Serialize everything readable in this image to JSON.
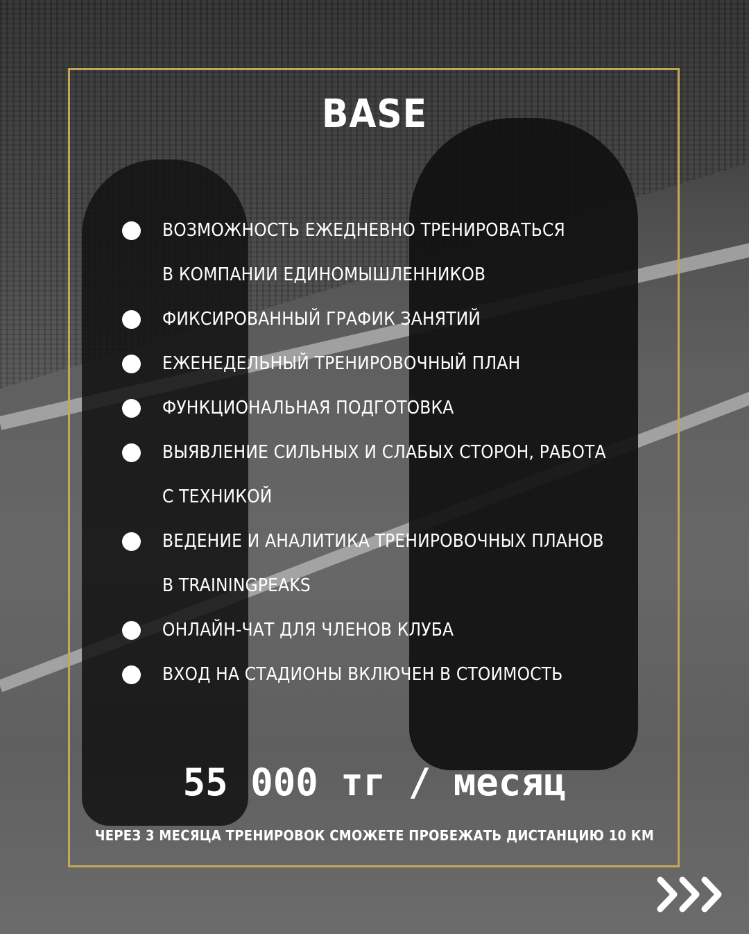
{
  "card": {
    "title": "BASE",
    "features": [
      "ВОЗМОЖНОСТЬ ЕЖЕДНЕВНО ТРЕНИРОВАТЬСЯ",
      "В КОМПАНИИ ЕДИНОМЫШЛЕННИКОВ",
      "ФИКСИРОВАННЫЙ ГРАФИК ЗАНЯТИЙ",
      "ЕЖЕНЕДЕЛЬНЫЙ ТРЕНИРОВОЧНЫЙ ПЛАН",
      "ФУНКЦИОНАЛЬНАЯ ПОДГОТОВКА",
      "ВЫЯВЛЕНИЕ СИЛЬНЫХ И СЛАБЫХ СТОРОН, РАБОТА",
      "С ТЕХНИКОЙ",
      "ВЕДЕНИЕ И АНАЛИТИКА ТРЕНИРОВОЧНЫХ ПЛАНОВ",
      "В TRAININGPEAKS",
      "ОНЛАЙН-ЧАТ ДЛЯ ЧЛЕНОВ КЛУБА",
      "ВХОД НА СТАДИОНЫ ВКЛЮЧЕН В СТОИМОСТЬ"
    ],
    "bulleted": [
      true,
      false,
      true,
      true,
      true,
      true,
      false,
      true,
      false,
      true,
      true
    ],
    "price": "55 000 тг / месяц",
    "note": "ЧЕРЕЗ 3 МЕСЯЦА ТРЕНИРОВОК СМОЖЕТЕ ПРОБЕЖАТЬ ДИСТАНЦИЮ 10 КМ"
  },
  "navigation": {
    "next_icon": "triple-chevron-right-icon"
  },
  "colors": {
    "frame": "#c2a95a",
    "text": "#ffffff",
    "bullet": "#ffffff"
  }
}
